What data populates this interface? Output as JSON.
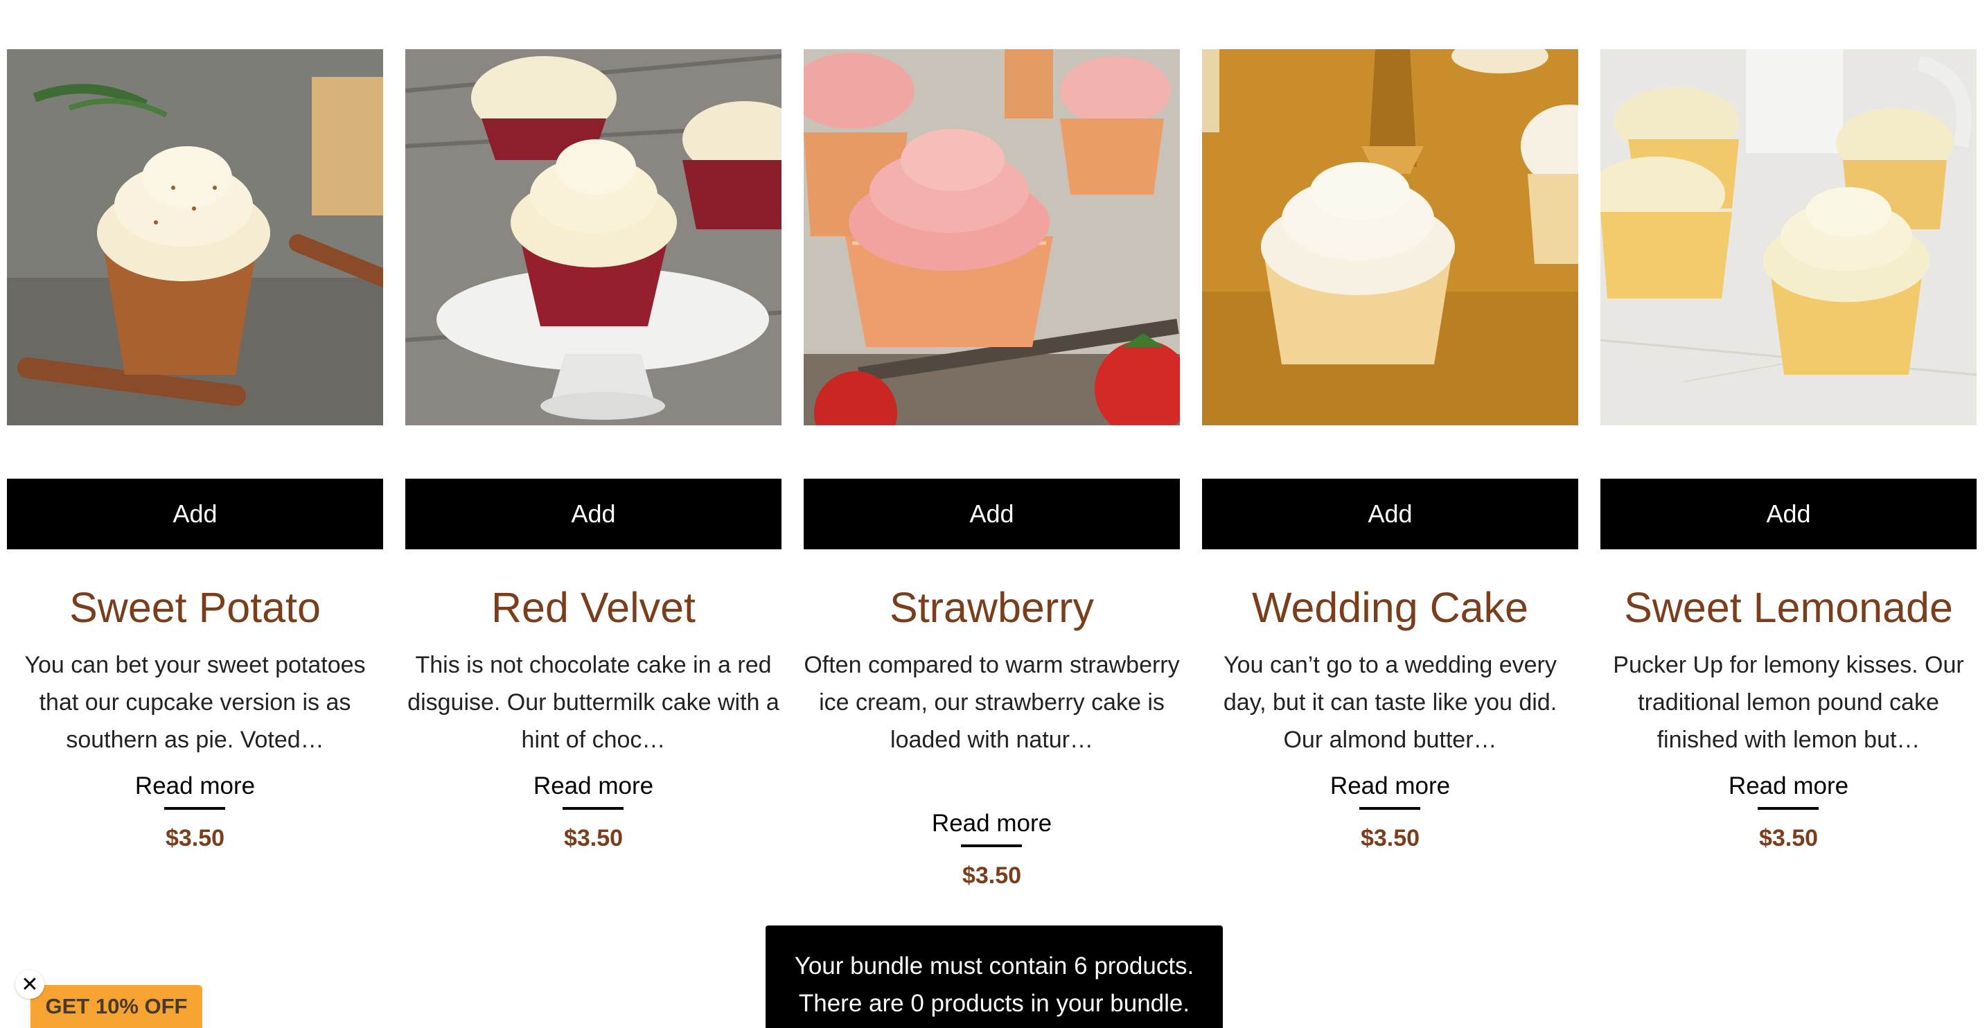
{
  "products": [
    {
      "image": "sweet-potato-cupcake-photo",
      "add_label": "Add",
      "title": "Sweet Potato",
      "description": "You can bet your sweet potatoes that our cupcake version is as southern as pie. Voted…",
      "read_more": "Read more",
      "price": "$3.50"
    },
    {
      "image": "red-velvet-cupcake-photo",
      "add_label": "Add",
      "title": "Red Velvet",
      "description": "This is not chocolate cake in a red disguise. Our buttermilk cake with a hint of choc…",
      "read_more": "Read more",
      "price": "$3.50"
    },
    {
      "image": "strawberry-cupcake-photo",
      "add_label": "Add",
      "title": "Strawberry",
      "description": "Often compared to warm strawberry ice cream, our strawberry cake is loaded with natur…",
      "read_more": "Read more",
      "price": "$3.50"
    },
    {
      "image": "wedding-cake-cupcake-photo",
      "add_label": "Add",
      "title": "Wedding Cake",
      "description": "You can’t go to a wedding every day, but it can taste like you did. Our almond butter…",
      "read_more": "Read more",
      "price": "$3.50"
    },
    {
      "image": "sweet-lemonade-cupcake-photo",
      "add_label": "Add",
      "title": "Sweet Lemonade",
      "description": "Pucker Up for lemony kisses. Our traditional lemon pound cake finished with lemon but…",
      "read_more": "Read more",
      "price": "$3.50"
    }
  ],
  "bundle_notice": {
    "line1": "Your bundle must contain 6 products.",
    "line2": "There are 0 products in your bundle."
  },
  "promo": {
    "label": "GET 10% OFF",
    "close_icon": "close-icon"
  },
  "colors": {
    "title": "#7a3e1d",
    "button": "#000000",
    "promo": "#f6a331"
  }
}
